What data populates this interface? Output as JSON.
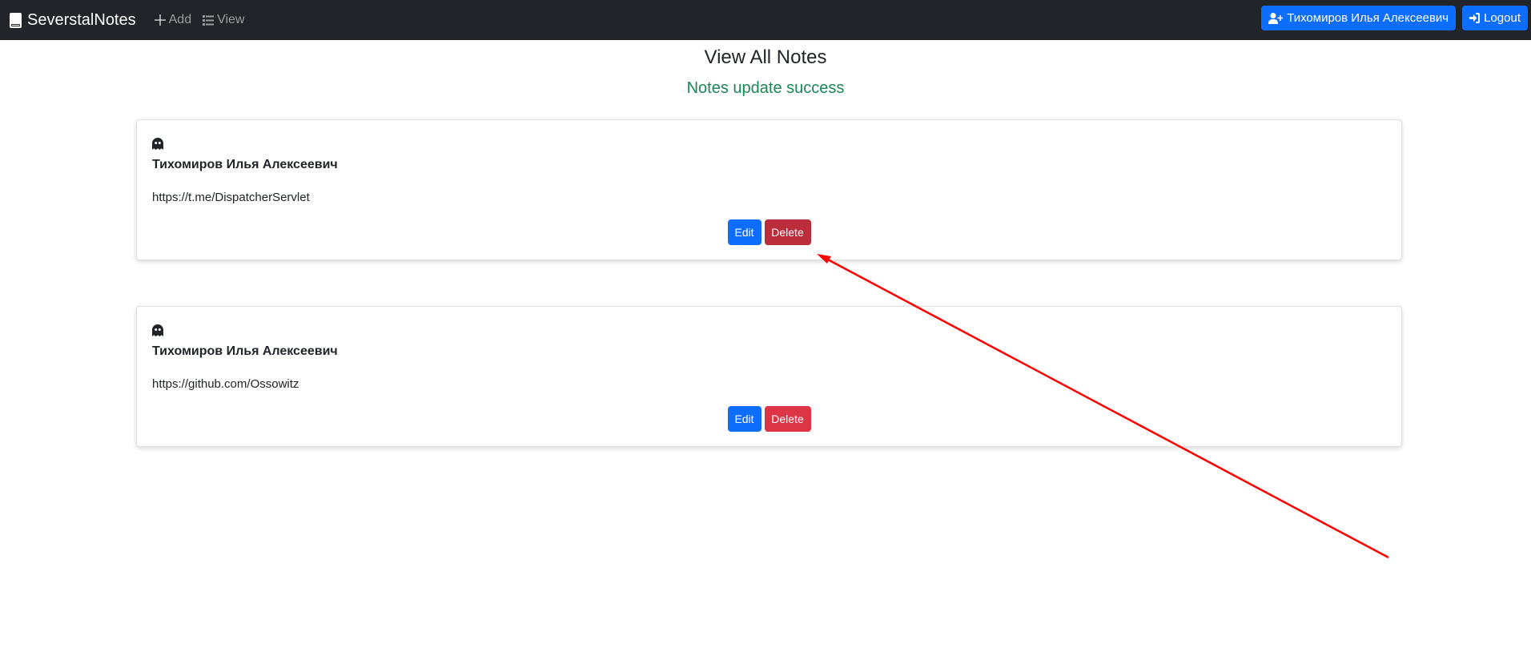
{
  "navbar": {
    "brand": "SeverstalNotes",
    "brand_icon": "book-icon",
    "links": [
      {
        "label": "Add",
        "icon": "plus-icon"
      },
      {
        "label": "View",
        "icon": "list-icon"
      }
    ],
    "user_button": "Тихомиров Илья Алексеевич",
    "user_icon": "user-plus-icon",
    "logout_button": "Logout",
    "logout_icon": "sign-in-icon",
    "background_color": "#212529"
  },
  "main": {
    "title": "View All Notes",
    "status_message": "Notes update success",
    "status_color": "#198754"
  },
  "notes": [
    {
      "icon": "ghost-icon",
      "author": "Тихомиров Илья Алексеевич",
      "text": "https://t.me/DispatcherServlet",
      "edit_label": "Edit",
      "delete_label": "Delete",
      "delete_hovered": true
    },
    {
      "icon": "ghost-icon",
      "author": "Тихомиров Илья Алексеевич",
      "text": "https://github.com/Ossowitz",
      "edit_label": "Edit",
      "delete_label": "Delete",
      "delete_hovered": false
    }
  ],
  "colors": {
    "primary": "#0d6efd",
    "danger": "#dc3545",
    "danger_hover": "#bb2d3b",
    "annotation_arrow": "#ff0000"
  }
}
